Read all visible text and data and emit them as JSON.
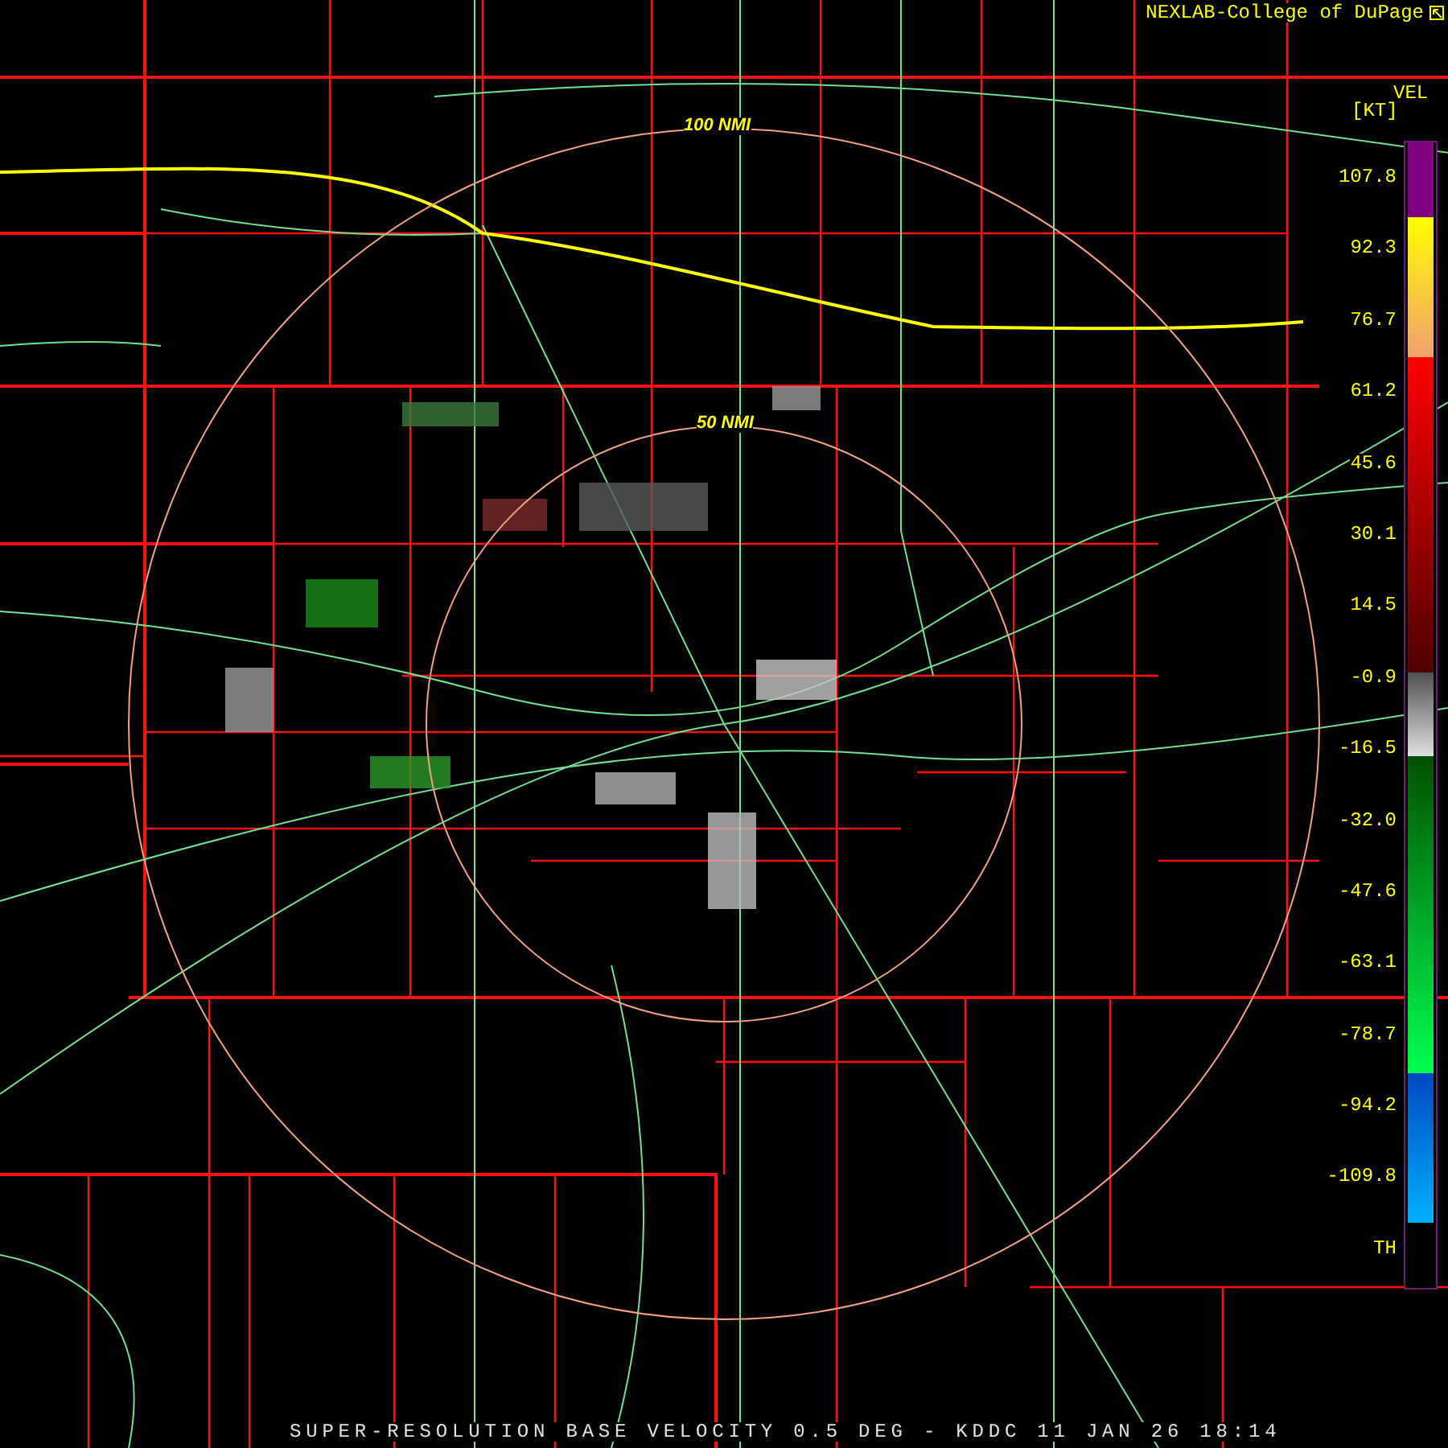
{
  "credit": "NEXLAB-College of DuPage",
  "rings": [
    {
      "label": "100 NMI"
    },
    {
      "label": "50 NMI"
    }
  ],
  "legend": {
    "title": "VEL",
    "unit": "[KT]",
    "ticks": [
      "107.8",
      "92.3",
      "76.7",
      "61.2",
      "45.6",
      "30.1",
      "14.5",
      "-0.9",
      "-16.5",
      "-32.0",
      "-47.6",
      "-63.1",
      "-78.7",
      "-94.2",
      "-109.8",
      "TH"
    ]
  },
  "caption": "SUPER-RESOLUTION BASE VELOCITY 0.5 DEG - KDDC 11 JAN 26 18:14"
}
